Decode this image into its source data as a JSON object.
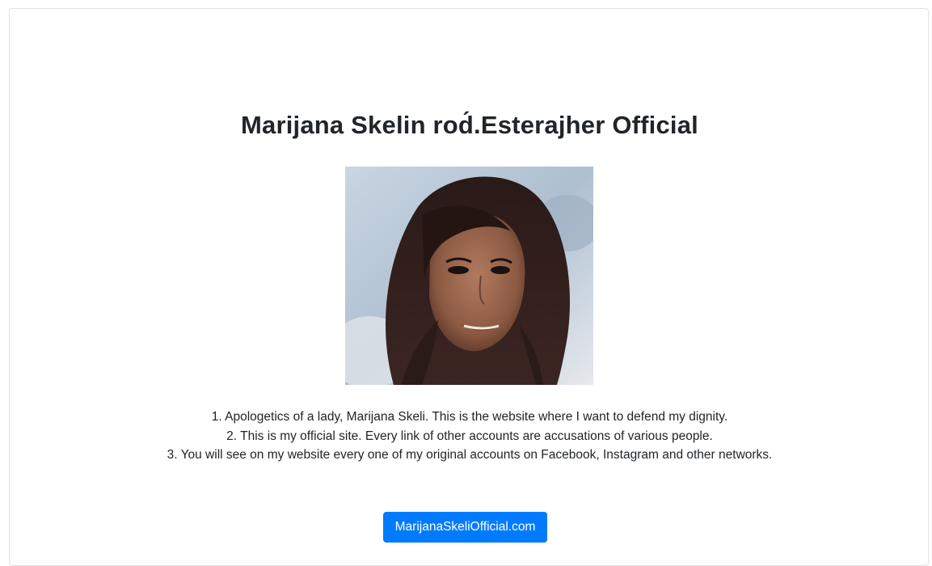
{
  "page": {
    "title": "Marijana Skelin rod́.Esterajher Official"
  },
  "photo": {
    "name": "profile-photo"
  },
  "content": {
    "lines": [
      "1. Apologetics of a lady, Marijana Skeli. This is the website where I want to defend my dignity.",
      "2. This is my official site. Every link of other accounts are accusations of various people.",
      "3. You will see on my website every one of my original accounts on Facebook, Instagram and other networks."
    ]
  },
  "cta": {
    "label": "MarijanaSkeliOfficial.com"
  },
  "colors": {
    "accent": "#007bff",
    "text": "#212529",
    "border": "#dee2e6"
  }
}
